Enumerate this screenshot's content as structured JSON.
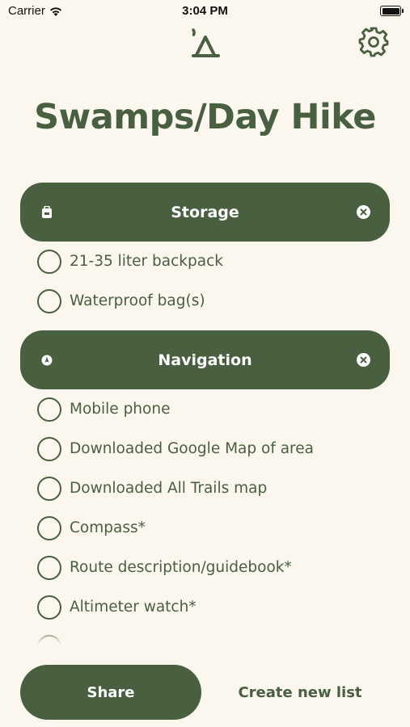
{
  "status_bar": {
    "carrier": "Carrier",
    "time": "3:04 PM"
  },
  "header": {
    "logo_icon": "tent-icon",
    "settings_icon": "gear-icon"
  },
  "title": "Swamps/Day Hike",
  "categories": [
    {
      "label": "Storage",
      "icon": "backpack-icon",
      "items": [
        "21-35 liter backpack",
        "Waterproof bag(s)"
      ]
    },
    {
      "label": "Navigation",
      "icon": "compass-icon",
      "items": [
        "Mobile phone",
        "Downloaded Google Map of area",
        "Downloaded All Trails map",
        "Compass*",
        "Route description/guidebook*",
        "Altimeter watch*"
      ]
    }
  ],
  "footer": {
    "share_label": "Share",
    "create_label": "Create new list"
  },
  "colors": {
    "background": "#FBF6EE",
    "accent": "#48603F",
    "text": "#48603F"
  }
}
